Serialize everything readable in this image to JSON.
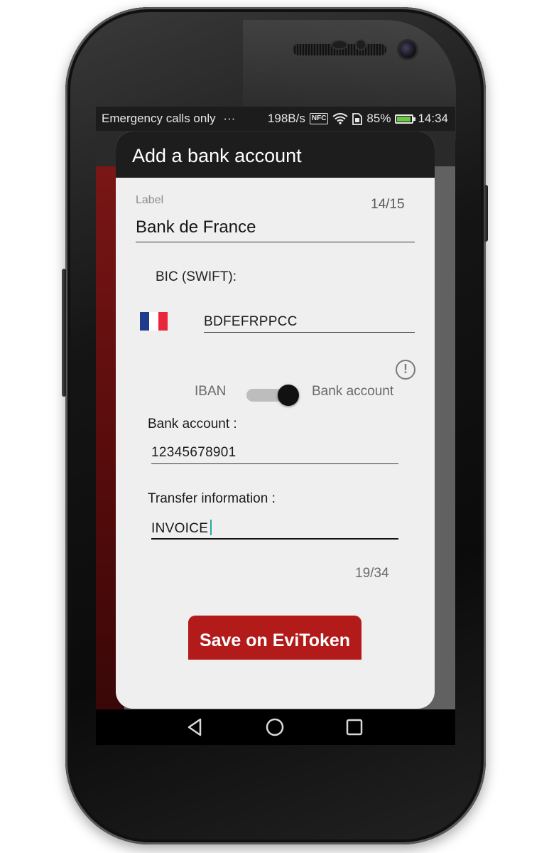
{
  "status_bar": {
    "carrier": "Emergency calls only",
    "more": "···",
    "speed": "198B/s",
    "nfc": "NFC",
    "battery": "85%",
    "time": "14:34"
  },
  "dialog": {
    "title": "Add a bank account",
    "label_field": {
      "floating_label": "Label",
      "counter": "14/15",
      "value": "Bank de France"
    },
    "bic": {
      "title": "BIC (SWIFT):",
      "country_flag": "france-flag",
      "value": "BDFEFRPPCC"
    },
    "toggle": {
      "left_label": "IBAN",
      "right_label": "Bank account",
      "selected": "Bank account"
    },
    "bank_account": {
      "title": "Bank account :",
      "value": "12345678901"
    },
    "transfer_info": {
      "title": "Transfer information :",
      "value": "INVOICE",
      "counter": "19/34"
    },
    "save_button": "Save on EviToken"
  },
  "colors": {
    "accent_red": "#b31b1b",
    "dialog_bg": "#efefef",
    "header_bg": "#1d1d1d"
  }
}
